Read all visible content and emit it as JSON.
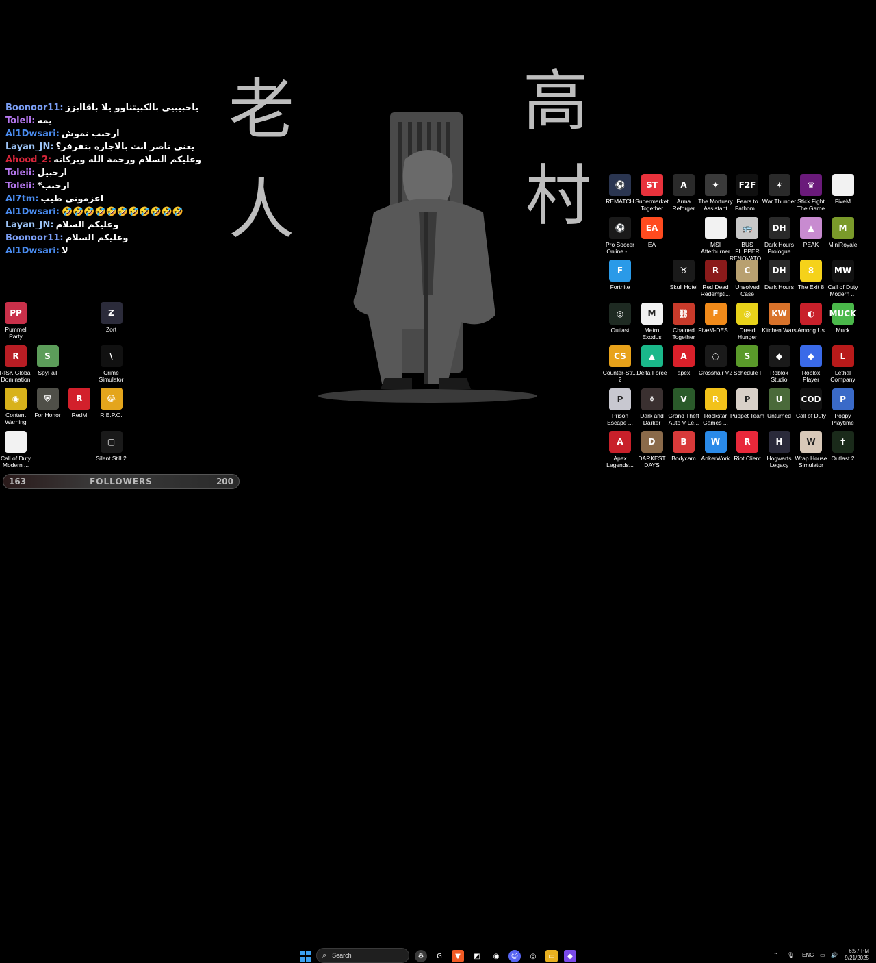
{
  "wallpaper": {
    "kanji_left": [
      "老",
      "人"
    ],
    "kanji_right": [
      "高",
      "村"
    ]
  },
  "chat": [
    {
      "user": "Boonoor11:",
      "color": "#7b9ff6",
      "msg": "ياحبيبيي بالكبيتناوو يلا باقاابزز"
    },
    {
      "user": "Toleli:",
      "color": "#b778f0",
      "msg": "يمه"
    },
    {
      "user": "Al1Dwsari:",
      "color": "#4a8cf0",
      "msg": "ارحبب نموش"
    },
    {
      "user": "Layan_JN:",
      "color": "#9cc3f5",
      "msg": "يعني ناصر انت بالاجازه بتفرفر؟"
    },
    {
      "user": "Ahood_2:",
      "color": "#d5263a",
      "msg": "وعليكم السلام ورحمة الله وبركاته"
    },
    {
      "user": "Toleii:",
      "color": "#b778f0",
      "msg": "ارحبيل"
    },
    {
      "user": "Toleii:",
      "color": "#b778f0",
      "msg": "ارحبب*"
    },
    {
      "user": "Al7tm:",
      "color": "#4a8cf0",
      "msg": "اعزموني طيب"
    },
    {
      "user": "Al1Dwsari:",
      "color": "#4a8cf0",
      "msg": "🤣🤣🤣🤣🤣🤣🤣🤣🤣🤣🤣"
    },
    {
      "user": "Layan_JN:",
      "color": "#9cc3f5",
      "msg": "وعليكم السلام"
    },
    {
      "user": "Boonoor11:",
      "color": "#7b9ff6",
      "msg": "وعليكم السلام"
    },
    {
      "user": "Al1Dwsari:",
      "color": "#4a8cf0",
      "msg": "لا"
    }
  ],
  "left_icons": [
    {
      "label": "Pummel Party",
      "color": "#c9304a",
      "glyph": "PP",
      "col": 0,
      "row": 0
    },
    {
      "label": "Zort",
      "color": "#2b2b3a",
      "glyph": "Z",
      "col": 3,
      "row": 0
    },
    {
      "label": "RISK Global Domination",
      "color": "#b81d24",
      "glyph": "R",
      "col": 0,
      "row": 1
    },
    {
      "label": "SpyFall",
      "color": "#5c9d5a",
      "glyph": "S",
      "col": 1,
      "row": 1
    },
    {
      "label": "Crime Simulator",
      "color": "#111111",
      "glyph": "\\",
      "col": 3,
      "row": 1
    },
    {
      "label": "Content Warning",
      "color": "#d8b21b",
      "glyph": "◉",
      "col": 0,
      "row": 2
    },
    {
      "label": "For Honor",
      "color": "#4f4f48",
      "glyph": "⛨",
      "col": 1,
      "row": 2
    },
    {
      "label": "RedM",
      "color": "#d2202b",
      "glyph": "R",
      "col": 2,
      "row": 2
    },
    {
      "label": "R.E.P.O.",
      "color": "#e4a51c",
      "glyph": "😂",
      "col": 3,
      "row": 2
    },
    {
      "label": "Call of Duty Modern ...",
      "color": "#f2f2f2",
      "glyph": "",
      "col": 0,
      "row": 3
    },
    {
      "label": "Silent Still 2",
      "color": "#1a1a1a",
      "glyph": "▢",
      "col": 3,
      "row": 3
    }
  ],
  "right_icons": [
    {
      "label": "REMATCH",
      "color": "#2a3550",
      "glyph": "⚽",
      "col": 0,
      "row": 0
    },
    {
      "label": "Supermarket Together",
      "color": "#e8323c",
      "glyph": "ST",
      "col": 1,
      "row": 0
    },
    {
      "label": "Arma Reforger",
      "color": "#2a2a2a",
      "glyph": "A",
      "col": 2,
      "row": 0
    },
    {
      "label": "The Mortuary Assistant",
      "color": "#3a3a3a",
      "glyph": "✦",
      "col": 3,
      "row": 0
    },
    {
      "label": "Fears to Fathom...",
      "color": "#101010",
      "glyph": "F2F",
      "col": 4,
      "row": 0
    },
    {
      "label": "War Thunder",
      "color": "#2a2a2a",
      "glyph": "✶",
      "col": 5,
      "row": 0
    },
    {
      "label": "Stick Fight The Game",
      "color": "#6a1a7a",
      "glyph": "♛",
      "col": 6,
      "row": 0
    },
    {
      "label": "FiveM",
      "color": "#f2f2f2",
      "glyph": "",
      "col": 7,
      "row": 0
    },
    {
      "label": "Pro Soccer Online - ...",
      "color": "#1a1a1a",
      "glyph": "⚽",
      "col": 0,
      "row": 1
    },
    {
      "label": "EA",
      "color": "#ff4b1f",
      "glyph": "EA",
      "col": 1,
      "row": 1
    },
    {
      "label": "MSI Afterburner",
      "color": "#f2f2f2",
      "glyph": "",
      "col": 3,
      "row": 1
    },
    {
      "label": "BUS FLIPPER RENOVATO...",
      "color": "#c8c8c8",
      "glyph": "🚌",
      "col": 4,
      "row": 1
    },
    {
      "label": "Dark Hours Prologue",
      "color": "#2a2a2a",
      "glyph": "DH",
      "col": 5,
      "row": 1
    },
    {
      "label": "PEAK",
      "color": "#c88bd0",
      "glyph": "▲",
      "col": 6,
      "row": 1
    },
    {
      "label": "MiniRoyale",
      "color": "#7a9a2a",
      "glyph": "M",
      "col": 7,
      "row": 1
    },
    {
      "label": "Fortnite",
      "color": "#2a9ae8",
      "glyph": "F",
      "col": 0,
      "row": 2
    },
    {
      "label": "Skull Hotel",
      "color": "#1a1a1a",
      "glyph": "♉",
      "col": 2,
      "row": 2
    },
    {
      "label": "Red Dead Redempti...",
      "color": "#8a1a1a",
      "glyph": "R",
      "col": 3,
      "row": 2
    },
    {
      "label": "Unsolved Case",
      "color": "#b8a070",
      "glyph": "C",
      "col": 4,
      "row": 2
    },
    {
      "label": "Dark Hours",
      "color": "#2a2a2a",
      "glyph": "DH",
      "col": 5,
      "row": 2
    },
    {
      "label": "The Exit 8",
      "color": "#f5d21a",
      "glyph": "8",
      "col": 6,
      "row": 2
    },
    {
      "label": "Call of Duty Modern ...",
      "color": "#111111",
      "glyph": "MW",
      "col": 7,
      "row": 2
    },
    {
      "label": "Outlast",
      "color": "#1e2a22",
      "glyph": "◎",
      "col": 0,
      "row": 3
    },
    {
      "label": "Metro Exodus",
      "color": "#f2f2f2",
      "glyph": "M",
      "col": 1,
      "row": 3
    },
    {
      "label": "Chained Together",
      "color": "#c83a2a",
      "glyph": "⛓",
      "col": 2,
      "row": 3
    },
    {
      "label": "FiveM-DES...",
      "color": "#f08a1a",
      "glyph": "F",
      "col": 3,
      "row": 3
    },
    {
      "label": "Dread Hunger",
      "color": "#e8d21a",
      "glyph": "◎",
      "col": 4,
      "row": 3
    },
    {
      "label": "Kitchen Wars",
      "color": "#d8722a",
      "glyph": "KW",
      "col": 5,
      "row": 3
    },
    {
      "label": "Among Us",
      "color": "#c8202a",
      "glyph": "◐",
      "col": 6,
      "row": 3
    },
    {
      "label": "Muck",
      "color": "#4ab84a",
      "glyph": "MUCK",
      "col": 7,
      "row": 3
    },
    {
      "label": "Counter-Str... 2",
      "color": "#e8a21a",
      "glyph": "CS",
      "col": 0,
      "row": 4
    },
    {
      "label": "Delta Force",
      "color": "#1ab88a",
      "glyph": "▲",
      "col": 1,
      "row": 4
    },
    {
      "label": "apex",
      "color": "#d8202a",
      "glyph": "A",
      "col": 2,
      "row": 4
    },
    {
      "label": "Crosshair V2",
      "color": "#1a1a1a",
      "glyph": "◌",
      "col": 3,
      "row": 4
    },
    {
      "label": "Schedule I",
      "color": "#5a9a2a",
      "glyph": "S",
      "col": 4,
      "row": 4
    },
    {
      "label": "Roblox Studio",
      "color": "#1a1a1a",
      "glyph": "◆",
      "col": 5,
      "row": 4
    },
    {
      "label": "Roblox Player",
      "color": "#3a6ae8",
      "glyph": "◆",
      "col": 6,
      "row": 4
    },
    {
      "label": "Lethal Company",
      "color": "#b81a1a",
      "glyph": "L",
      "col": 7,
      "row": 4
    },
    {
      "label": "Prison Escape ...",
      "color": "#c8c8d0",
      "glyph": "P",
      "col": 0,
      "row": 5
    },
    {
      "label": "Dark and Darker",
      "color": "#3a3030",
      "glyph": "⚱",
      "col": 1,
      "row": 5
    },
    {
      "label": "Grand Theft Auto V Le...",
      "color": "#2a5a2a",
      "glyph": "V",
      "col": 2,
      "row": 5
    },
    {
      "label": "Rockstar Games ...",
      "color": "#f2c21a",
      "glyph": "R",
      "col": 3,
      "row": 5
    },
    {
      "label": "Puppet Team",
      "color": "#d8d0c8",
      "glyph": "P",
      "col": 4,
      "row": 5
    },
    {
      "label": "Unturned",
      "color": "#4a6a3a",
      "glyph": "U",
      "col": 5,
      "row": 5
    },
    {
      "label": "Call of Duty",
      "color": "#111111",
      "glyph": "COD",
      "col": 6,
      "row": 5
    },
    {
      "label": "Poppy Playtime",
      "color": "#3a6ac8",
      "glyph": "P",
      "col": 7,
      "row": 5
    },
    {
      "label": "Apex Legends...",
      "color": "#c8202a",
      "glyph": "A",
      "col": 0,
      "row": 6
    },
    {
      "label": "DARKEST DAYS",
      "color": "#8a6a4a",
      "glyph": "D",
      "col": 1,
      "row": 6
    },
    {
      "label": "Bodycam",
      "color": "#d83a3a",
      "glyph": "B",
      "col": 2,
      "row": 6
    },
    {
      "label": "AnkerWork",
      "color": "#2a8ae8",
      "glyph": "W",
      "col": 3,
      "row": 6
    },
    {
      "label": "Riot Client",
      "color": "#e8283a",
      "glyph": "R",
      "col": 4,
      "row": 6
    },
    {
      "label": "Hogwarts Legacy",
      "color": "#2a2a3a",
      "glyph": "H",
      "col": 5,
      "row": 6
    },
    {
      "label": "Wrap House Simulator",
      "color": "#d8c8b8",
      "glyph": "W",
      "col": 6,
      "row": 6
    },
    {
      "label": "Outlast 2",
      "color": "#1a2a1a",
      "glyph": "✝",
      "col": 7,
      "row": 6
    }
  ],
  "followers": {
    "current": "163",
    "label": "FOLLOWERS",
    "goal": "200"
  },
  "taskbar": {
    "search_placeholder": "Search",
    "language": "ENG",
    "time": "6:57 PM",
    "date": "9/21/2025"
  }
}
